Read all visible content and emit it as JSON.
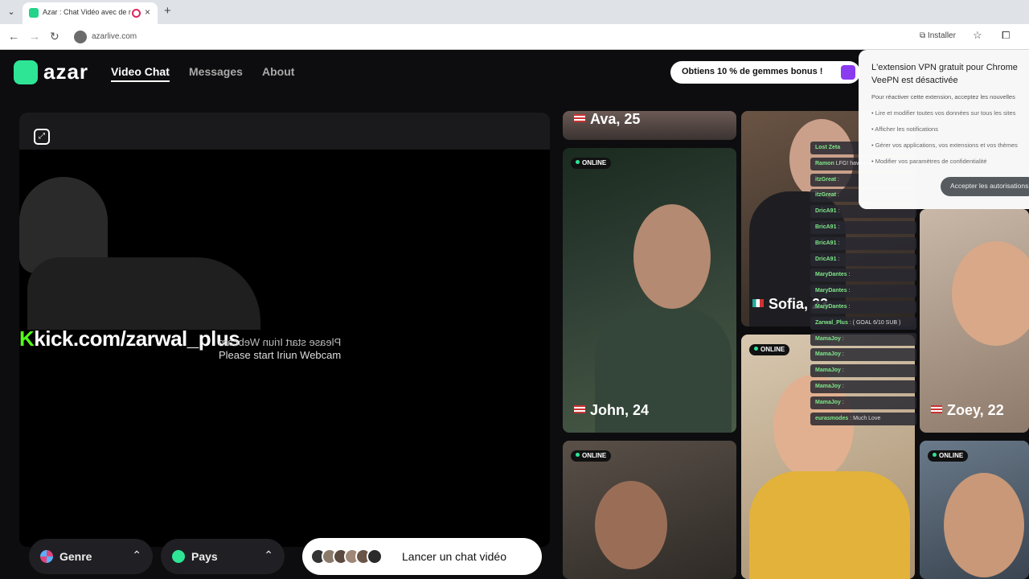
{
  "browser": {
    "tab_title": "Azar : Chat Vidéo avec de n",
    "new_tab": "+",
    "url": "azarlive.com",
    "install_label": "Installer"
  },
  "header": {
    "logo": "azar",
    "nav": [
      "Video Chat",
      "Messages",
      "About"
    ],
    "promo": "Obtiens 10 % de gemmes bonus !"
  },
  "video": {
    "watermark_k": "K",
    "watermark_rest": "kick.com/zarwal_plus",
    "mirrored_message": "Please start Iriun Webcam",
    "message": "Please start Iriun Webcam"
  },
  "controls": {
    "genre": "Genre",
    "pays": "Pays",
    "launch": "Lancer un chat vidéo"
  },
  "profiles": {
    "online_label": "ONLINE",
    "ava": "Ava, 25",
    "john": "John, 24",
    "sofia": "Sofia, 23",
    "zoey": "Zoey, 22"
  },
  "chat": [
    {
      "user": "Lost Zeta",
      "msg": ""
    },
    {
      "user": "Ramon",
      "msg": "LFG! have a great stream and a blessed day, much love"
    },
    {
      "user": "itzGreat",
      "msg": ":"
    },
    {
      "user": "itzGreat",
      "msg": ":"
    },
    {
      "user": "DricA91",
      "msg": ":"
    },
    {
      "user": "BricA91",
      "msg": ":"
    },
    {
      "user": "BricA91",
      "msg": ":"
    },
    {
      "user": "DricA91",
      "msg": ":"
    },
    {
      "user": "MaryDantes",
      "msg": ":"
    },
    {
      "user": "MaryDantes",
      "msg": ":"
    },
    {
      "user": "MaryDantes",
      "msg": ":"
    },
    {
      "user": "Zarwal_Plus",
      "msg": ": ( GOAL 6/10 SUB )"
    },
    {
      "user": "MamaJoy",
      "msg": ":"
    },
    {
      "user": "MamaJoy",
      "msg": ":"
    },
    {
      "user": "MamaJoy",
      "msg": ":"
    },
    {
      "user": "MamaJoy",
      "msg": ":"
    },
    {
      "user": "MamaJoy",
      "msg": ":"
    },
    {
      "user": "eurasmodes",
      "msg": ": Much Love"
    }
  ],
  "popup": {
    "title_line1": "L'extension VPN gratuit pour Chrome",
    "title_line2": "VeePN est désactivée",
    "subtitle": "Pour réactiver cette extension, acceptez les nouvelles",
    "items": [
      "• Lire et modifier toutes vos données sur tous les sites",
      "• Afficher les notifications",
      "• Gérer vos applications, vos extensions et vos thèmes",
      "• Modifier vos paramètres de confidentialité"
    ],
    "button": "Accepter les autorisations"
  },
  "colors": {
    "brand_green": "#2ee596",
    "background": "#0d0d0f",
    "kick_green": "#53fc18"
  }
}
